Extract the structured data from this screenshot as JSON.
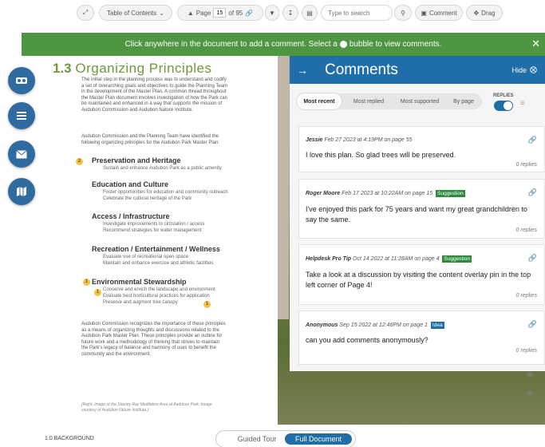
{
  "toolbar": {
    "toc_label": "Table of Contents",
    "page_label": "Page",
    "page_value": "15",
    "page_total": "of 95",
    "search_placeholder": "Type to search",
    "comment_label": "Comment",
    "drag_label": "Drag"
  },
  "banner": {
    "text_before": "Click anywhere in the document to add a comment. Select a",
    "text_after": "bubble to view comments."
  },
  "document": {
    "section_number": "1.3",
    "section_title": "Organizing Principles",
    "intro_lines": [
      "The initial step in the planning process was to understand and codify",
      "a set of overarching goals and objectives to guide the Planning Team",
      "in the development of the Master Plan. A common thread throughout",
      "the Master Plan document involves investigation of how the Park can",
      "be maintained and enhanced in a way that supports the mission of",
      "Audubon Commission and Audubon Nature Institute."
    ],
    "para2_lines": [
      "Audubon Commission and the Planning Team have identified the",
      "following organizing principles for the Audubon Park Master Plan:"
    ],
    "principles": [
      {
        "title": "Preservation and Heritage",
        "items": [
          "Sustain and enhance Audubon Park as a public amenity"
        ]
      },
      {
        "title": "Education and Culture",
        "items": [
          "Foster opportunities for education and community outreach",
          "Celebrate the cultural heritage of the Park"
        ]
      },
      {
        "title": "Access / Infrastructure",
        "items": [
          "Investigate improvements to circulation / access",
          "Recommend strategies for water management"
        ]
      },
      {
        "title": "Recreation / Entertainment / Wellness",
        "items": [
          "Evaluate use of recreational open space",
          "Maintain and enhance exercise and athletic facilities"
        ]
      },
      {
        "title": "Environmental Stewardship",
        "items": [
          "Conserve and enrich the landscape and environment",
          "Evaluate best horticultural practices for application",
          "Preserve and augment tree canopy"
        ]
      }
    ],
    "pin_counts": [
      "2",
      "1",
      "1",
      "1"
    ],
    "closing_lines": [
      "Audubon Commission recognizes the importance of these principles",
      "as a means of organizing thoughts and discussions related to the",
      "Audubon Park Master Plan. These principles provide an outline for",
      "future work and a methodology of thinking that strives to maintain",
      "the Park's legacy of balance and harmony of uses to benefit the",
      "community and the environment."
    ],
    "caption_lines": [
      "(Right: Image of the Stanley Ray Meditation Area at Audubon Park. Image",
      "courtesy of Audubon Nature Institute.)"
    ]
  },
  "comments_panel": {
    "title": "Comments",
    "hide_label": "Hide",
    "tabs": [
      "Most recent",
      "Most replied",
      "Most supported",
      "By page"
    ],
    "replies_label": "REPLIES",
    "replies_toggle_on": true,
    "comments": [
      {
        "author": "Jessie",
        "meta": "Feb 27 2023 at 4:19PM on page 55",
        "tag": "",
        "text": "I love this plan. So glad trees will be preserved.",
        "replies": "0 replies"
      },
      {
        "author": "Roger Moore",
        "meta": "Feb 17 2023 at 10:22AM on page 15",
        "tag": "Suggestion",
        "text": "I've enjoyed this park for 75 years and want my great grandchildren to say the same.",
        "replies": "0 replies"
      },
      {
        "author": "Helpdesk Pro Tip",
        "meta": "Oct 14 2022 at 11:28AM on page 4",
        "tag": "Suggestion",
        "text": "Take a look at a discussion by visiting the content overlay pin in the top left corner of Page 4!",
        "replies": "0 replies"
      },
      {
        "author": "Anonymous",
        "meta": "Sep 15 2022 at 12:46PM on page 1",
        "tag": "Idea",
        "text": "can you add comments anonymously?",
        "replies": "0 replies"
      }
    ]
  },
  "footer": {
    "section_label": "1.0 BACKGROUND",
    "guided_tour": "Guided Tour",
    "full_document": "Full Document"
  },
  "colors": {
    "accent_blue": "#1f6ea8",
    "banner_green": "#4f9642",
    "title_green": "#6d9a3a",
    "tag_suggestion": "#2e8b3e"
  }
}
